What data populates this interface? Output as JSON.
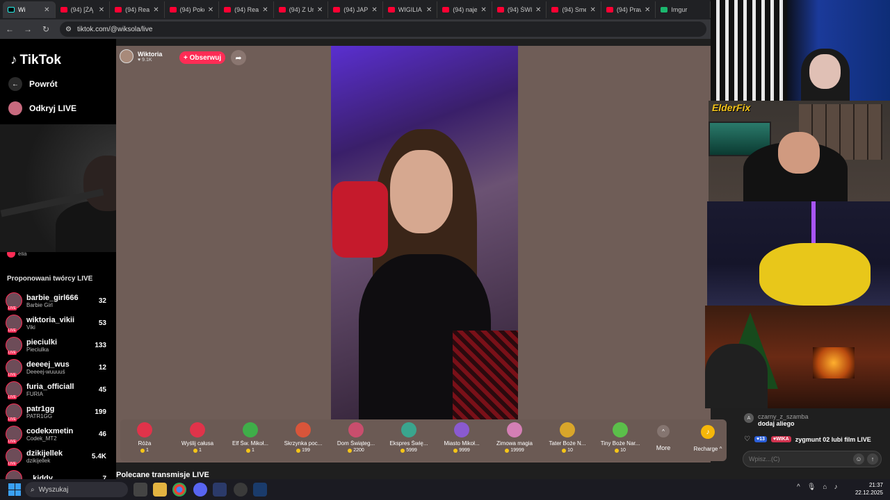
{
  "browser": {
    "tabs": [
      {
        "label": "Wi",
        "favicon": "tiktok-icon",
        "active": true
      },
      {
        "label": "(94) [ŻĄ",
        "favicon": "youtube-icon"
      },
      {
        "label": "(94) Real",
        "favicon": "youtube-icon"
      },
      {
        "label": "(94) Poke",
        "favicon": "youtube-icon"
      },
      {
        "label": "(94) Real",
        "favicon": "youtube-icon"
      },
      {
        "label": "(94) Z Ur",
        "favicon": "youtube-icon"
      },
      {
        "label": "(94) JAPO",
        "favicon": "youtube-icon"
      },
      {
        "label": "WIGILIA",
        "favicon": "youtube-icon"
      },
      {
        "label": "(94) naje",
        "favicon": "youtube-icon"
      },
      {
        "label": "(94) ŚWI",
        "favicon": "youtube-icon"
      },
      {
        "label": "(94) Sme",
        "favicon": "youtube-icon"
      },
      {
        "label": "(94) Prav",
        "favicon": "youtube-icon"
      },
      {
        "label": "Imgur",
        "favicon": "imgur-icon"
      }
    ],
    "url": "tiktok.com/@wiksola/live"
  },
  "sidebar": {
    "logo": "TikTok",
    "back_label": "Powrót",
    "discover_label": "Odkryj LIVE",
    "partial_item": "ella",
    "suggested_title": "Proponowani twórcy LIVE",
    "creators": [
      {
        "name": "barbie_girl666",
        "sub": "Barbie Girl",
        "count": "32"
      },
      {
        "name": "wiktoria_vikii",
        "sub": "Viki",
        "count": "53"
      },
      {
        "name": "pieciulki",
        "sub": "Pieciulka",
        "count": "133"
      },
      {
        "name": "deeeej_wus",
        "sub": "Deeeej-wuuuuś",
        "count": "12"
      },
      {
        "name": "furia_officiall",
        "sub": "FURIA",
        "count": "45"
      },
      {
        "name": "patr1gg",
        "sub": "PATR1GG",
        "count": "199"
      },
      {
        "name": "codekxmetin",
        "sub": "Codek_MT2",
        "count": "46"
      },
      {
        "name": "dzikijellek",
        "sub": "dzikijellek",
        "count": "5.4K"
      },
      {
        "name": "...kiddy",
        "sub": "",
        "count": "7"
      }
    ]
  },
  "stream": {
    "host_name": "Wiktoria",
    "host_likes": "9.1K",
    "follow_label": "+ Obserwuj",
    "recommended_label": "Polecane transmisje LIVE"
  },
  "gifts": [
    {
      "name": "Róża",
      "price": "1",
      "color": "#e0334a"
    },
    {
      "name": "Wyślij całusa",
      "price": "1",
      "color": "#e0334a"
    },
    {
      "name": "Elf Św. Mikoł...",
      "price": "1",
      "color": "#3fae49"
    },
    {
      "name": "Skrzynka poc...",
      "price": "199",
      "color": "#d9553a"
    },
    {
      "name": "Dom Świąteg...",
      "price": "2200",
      "color": "#c94e6d"
    },
    {
      "name": "Ekspres Świę...",
      "price": "5999",
      "color": "#3aa58e"
    },
    {
      "name": "Miasto Mikoł...",
      "price": "9999",
      "color": "#8a5ad0"
    },
    {
      "name": "Zimowa magia",
      "price": "19999",
      "color": "#d47fb5"
    },
    {
      "name": "Tater Boże N...",
      "price": "10",
      "color": "#d9a62a"
    },
    {
      "name": "Tiny Boże Nar...",
      "price": "10",
      "color": "#5bbf4a"
    }
  ],
  "more_label": "More",
  "recharge_label": "Recharge",
  "overlay_text": "ElderFix",
  "chat": {
    "msg1_avatar": "A",
    "msg1_user": "czarny_z_szamba",
    "msg1_text": "dodaj aliego",
    "msg2_level": "13",
    "msg2_fan": "WIKA",
    "msg2_text": "zygmunt 02 lubi film LIVE",
    "input_placeholder": "Wpisz...(C)"
  },
  "taskbar": {
    "search_label": "Wyszukaj",
    "time": "21:37",
    "date": "22.12.2025"
  }
}
